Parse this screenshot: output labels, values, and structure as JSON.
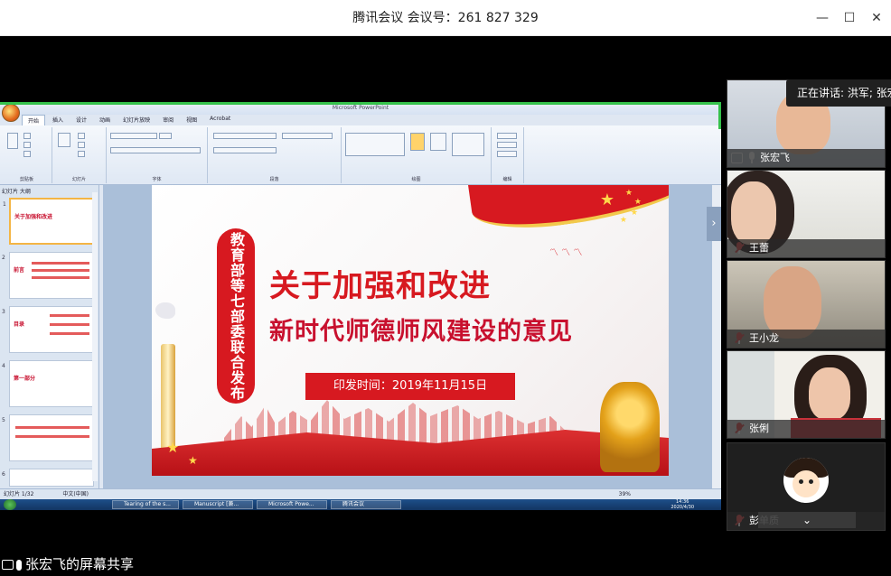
{
  "window": {
    "title": "腾讯会议 会议号：261 827 329",
    "minimize_glyph": "—",
    "maximize_glyph": "☐",
    "close_glyph": "✕"
  },
  "powerpoint": {
    "tabs": [
      "开始",
      "插入",
      "设计",
      "动画",
      "幻灯片放映",
      "审阅",
      "视图",
      "Acrobat"
    ],
    "ribbon_groups": [
      "剪贴板",
      "幻灯片",
      "字体",
      "段落",
      "绘图",
      "编辑"
    ],
    "thumb_tabs": "幻灯片  大纲",
    "status": "幻灯片 1/32",
    "status_lang": "中文(中国)",
    "zoom": "39%",
    "clock_time": "14:36",
    "clock_date": "2020/4/30",
    "taskbar_items": [
      "Tearing of the s...",
      "Manuscript [兼...",
      "Microsoft Powe...",
      "腾讯会议"
    ]
  },
  "slide": {
    "side_banner": "教育部等七部委联合发布",
    "title_line1": "关于加强和改进",
    "title_line2": "新时代师德师风建设的意见",
    "date_label": "印发时间：2019年11月15日"
  },
  "thumbnails": [
    {
      "num": "1",
      "label": "关于加强和改进"
    },
    {
      "num": "2",
      "label": "前言"
    },
    {
      "num": "3",
      "label": "目录"
    },
    {
      "num": "4",
      "label": "第一部分"
    },
    {
      "num": "5",
      "label": ""
    },
    {
      "num": "6",
      "label": ""
    }
  ],
  "participants": [
    {
      "name": "张宏飞",
      "mic": "on"
    },
    {
      "name": "王蕾",
      "mic": "muted"
    },
    {
      "name": "王小龙",
      "mic": "muted"
    },
    {
      "name": "张俐",
      "mic": "muted"
    },
    {
      "name": "彭单质",
      "mic": "muted"
    }
  ],
  "speaking_tip": "正在讲话: 洪军; 张宏",
  "sharer_label": "张宏飞的屏幕共享",
  "colors": {
    "accent_red": "#d71920",
    "share_green": "#35c14b"
  }
}
